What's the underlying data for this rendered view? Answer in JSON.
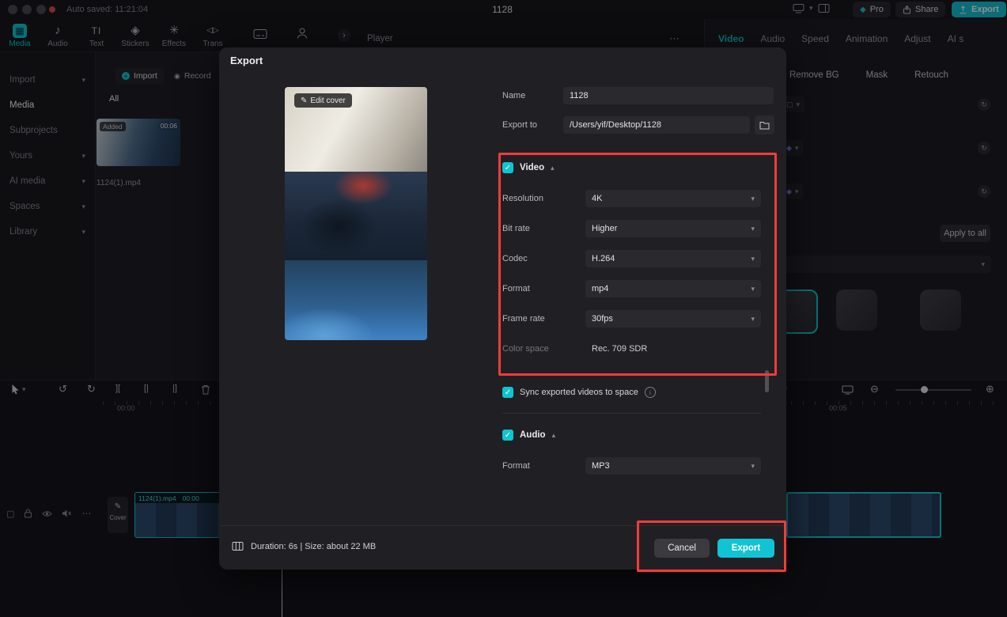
{
  "icons": {
    "caret_down": "▾",
    "caret_up": "▴",
    "check": "✓",
    "undo": "↺",
    "redo": "↻",
    "zoom_in": "⊕",
    "zoom_out": "⊖",
    "more": "⋯",
    "chevron_right": "›",
    "pencil": "✎",
    "music_note": "♪",
    "gem": "◆",
    "grid": "▦",
    "stickers": "◈",
    "effects": "✳",
    "transitions": "◁▷",
    "text_tool": "TI",
    "record_dot": "◉",
    "split": "][",
    "trim_left": "[|",
    "trim_right": "|]",
    "square": "▢",
    "ellipsis": "…",
    "plus": "+",
    "info": "i",
    "diamond_small": "◆"
  },
  "titlebar": {
    "auto_saved": "Auto saved: 11:21:04",
    "title": "1128",
    "pro": "Pro",
    "share": "Share",
    "export": "Export"
  },
  "top_toolbar": {
    "items": [
      {
        "label": "Media"
      },
      {
        "label": "Audio"
      },
      {
        "label": "Text"
      },
      {
        "label": "Stickers"
      },
      {
        "label": "Effects"
      },
      {
        "label": "Trans"
      }
    ]
  },
  "player": {
    "title": "Player"
  },
  "right_panel": {
    "tabs": [
      {
        "label": "Video"
      },
      {
        "label": "Audio"
      },
      {
        "label": "Speed"
      },
      {
        "label": "Animation"
      },
      {
        "label": "Adjust"
      },
      {
        "label": "AI s"
      }
    ],
    "subtabs": [
      {
        "label": "Remove BG"
      },
      {
        "label": "Mask"
      },
      {
        "label": "Retouch"
      }
    ],
    "apply_to_all": "Apply to all"
  },
  "sidebar": {
    "items": [
      {
        "label": "Import"
      },
      {
        "label": "Media"
      },
      {
        "label": "Subprojects"
      },
      {
        "label": "Yours"
      },
      {
        "label": "AI media"
      },
      {
        "label": "Spaces"
      },
      {
        "label": "Library"
      }
    ]
  },
  "media_panel": {
    "import_button": "Import",
    "record_button": "Record",
    "all_tab": "All",
    "clip": {
      "added_badge": "Added",
      "duration": "00:06",
      "name": "1124(1).mp4"
    }
  },
  "timeline": {
    "cover_button": "Cover",
    "clip_name": "1124(1).mp4",
    "clip_time": "00:00",
    "ruler_start": "00:00",
    "ruler_mid": "00:05"
  },
  "dialog": {
    "title": "Export",
    "edit_cover": "Edit cover",
    "fields": {
      "name_label": "Name",
      "name_value": "1128",
      "export_to_label": "Export to",
      "export_to_value": "/Users/yif/Desktop/1128"
    },
    "video": {
      "label": "Video",
      "rows": [
        {
          "label": "Resolution",
          "value": "4K"
        },
        {
          "label": "Bit rate",
          "value": "Higher"
        },
        {
          "label": "Codec",
          "value": "H.264"
        },
        {
          "label": "Format",
          "value": "mp4"
        },
        {
          "label": "Frame rate",
          "value": "30fps"
        }
      ],
      "color_space_label": "Color space",
      "color_space_value": "Rec. 709 SDR"
    },
    "sync_label": "Sync exported videos to space",
    "audio": {
      "label": "Audio",
      "format_label": "Format",
      "format_value": "MP3"
    },
    "footer": {
      "summary": "Duration: 6s | Size: about 22 MB",
      "cancel": "Cancel",
      "export": "Export"
    }
  }
}
